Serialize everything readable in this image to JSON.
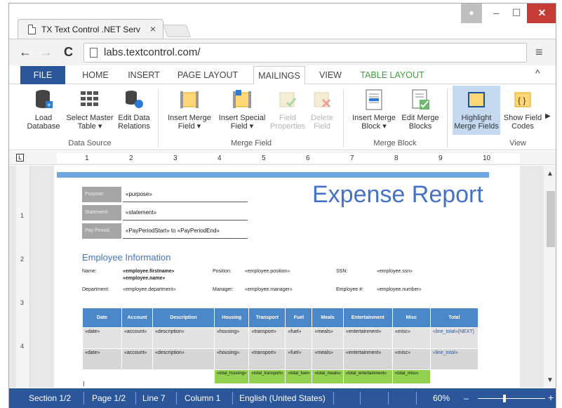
{
  "browser": {
    "tab_title": "TX Text Control .NET Serv",
    "tab_close": "×",
    "url": "labs.textcontrol.com/",
    "back": "←",
    "forward": "→",
    "reload": "C",
    "menu": "≡",
    "win_min": "–",
    "win_max": "☐",
    "win_close": "✕"
  },
  "ribbon": {
    "tabs": {
      "file": "FILE",
      "home": "HOME",
      "insert": "INSERT",
      "page_layout": "PAGE LAYOUT",
      "mailings": "MAILINGS",
      "view": "VIEW",
      "table_layout": "TABLE LAYOUT"
    },
    "collapse": "^",
    "buttons": {
      "load_database": "Load Database",
      "select_master_table": "Select Master Table ▾",
      "edit_data_relations": "Edit Data Relations",
      "insert_merge_field": "Insert Merge Field ▾",
      "insert_special_field": "Insert Special Field ▾",
      "field_properties": "Field Properties",
      "delete_field": "Delete Field",
      "insert_merge_block": "Insert Merge Block ▾",
      "edit_merge_blocks": "Edit Merge Blocks",
      "highlight_merge_fields": "Highlight Merge Fields",
      "show_field_codes": "Show Field Codes"
    },
    "groups": {
      "data_source": "Data Source",
      "merge_field": "Merge Field",
      "merge_block": "Merge Block",
      "view": "View"
    },
    "more": "▶"
  },
  "ruler": {
    "numbers": [
      "1",
      "2",
      "3",
      "4",
      "5",
      "6",
      "7",
      "8",
      "9",
      "10"
    ]
  },
  "vruler": {
    "numbers": [
      "1",
      "2",
      "3",
      "4"
    ]
  },
  "document": {
    "title": "Expense Report",
    "fields": [
      {
        "label": "Purpose:",
        "value": "«purpose»"
      },
      {
        "label": "Statement:",
        "value": "«statement»"
      },
      {
        "label": "Pay Period:",
        "value": "«PayPeriodStart» to «PayPeriodEnd»"
      }
    ],
    "employee_heading": "Employee Information",
    "employee": {
      "name_label": "Name:",
      "name_value": "«employee.firstname» «employee.name»",
      "position_label": "Position:",
      "position_value": "«employee.position»",
      "ssn_label": "SSN:",
      "ssn_value": "«employee.ssn»",
      "department_label": "Department:",
      "department_value": "«employee.department»",
      "manager_label": "Manager:",
      "manager_value": "«employee.manager»",
      "empno_label": "Employee #:",
      "empno_value": "«employee.number»"
    },
    "table": {
      "headers": [
        "Date",
        "Account",
        "Description",
        "Housing",
        "Transport",
        "Fuel",
        "Meals",
        "Entertainment",
        "Misc",
        "Total"
      ],
      "rows": [
        [
          "«date»",
          "«account»",
          "«description»",
          "«housing»",
          "«transport»",
          "«fuel»",
          "«meals»",
          "«entertainment»",
          "«misc»",
          "«line_total»{NEXT}"
        ],
        [
          "«date»",
          "«account»",
          "«description»",
          "«housing»",
          "«transport»",
          "«fuel»",
          "«meals»",
          "«entertainment»",
          "«misc»",
          "«line_total»"
        ]
      ],
      "sums": [
        "«total_housing»",
        "«total_transport»",
        "«total_fuel»",
        "«total_meals»",
        "«total_entertainment»",
        "«total_misc»"
      ]
    }
  },
  "status": {
    "section": "Section 1/2",
    "page": "Page 1/2",
    "line": "Line 7",
    "column": "Column 1",
    "language": "English (United States)",
    "zoom": "60%",
    "zoom_minus": "–",
    "zoom_plus": "+"
  }
}
